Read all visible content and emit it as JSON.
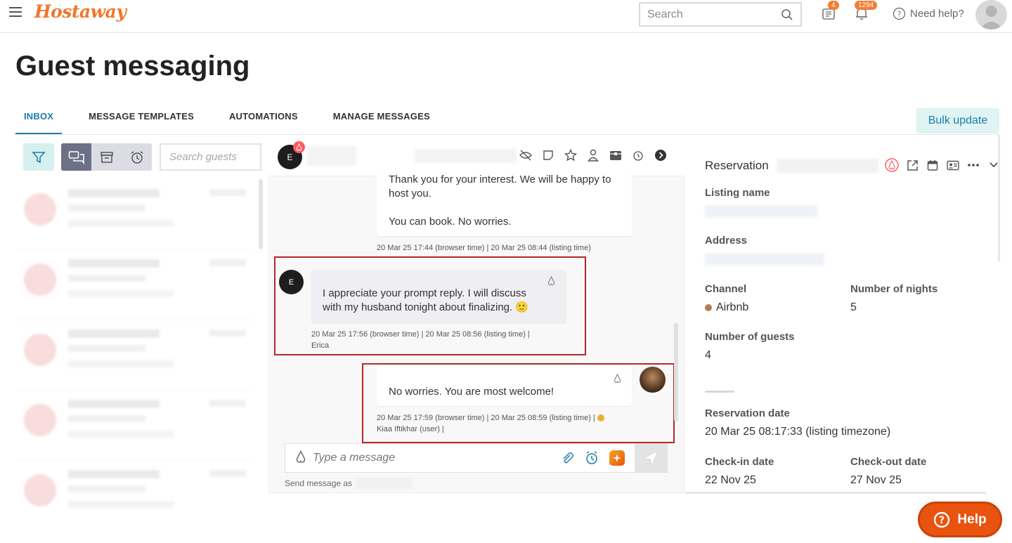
{
  "app": {
    "logo": "Hostaway"
  },
  "topbar": {
    "search_placeholder": "Search",
    "notifications_badge_1": "4",
    "notifications_badge_2": "1294",
    "need_help": "Need help?"
  },
  "page": {
    "title": "Guest messaging"
  },
  "tabs": [
    {
      "label": "INBOX",
      "active": true
    },
    {
      "label": "MESSAGE TEMPLATES"
    },
    {
      "label": "AUTOMATIONS"
    },
    {
      "label": "MANAGE MESSAGES"
    }
  ],
  "bulk_update": "Bulk update",
  "left": {
    "search_placeholder": "Search guests"
  },
  "chat": {
    "avatar_initial": "E",
    "messages": {
      "first_text_1": "Thank you for your interest. We will be happy to host you.",
      "first_text_2": "You can book. No worries.",
      "first_meta": "20 Mar 25 17:44 (browser time) | 20 Mar 25 08:44 (listing time)",
      "guest_initial": "E",
      "guest_text": "I appreciate your prompt reply. I will discuss with my husband tonight about finalizing. 🙂",
      "guest_meta_1": "20 Mar 25 17:56 (browser time) | 20 Mar 25 08:56 (listing time) |",
      "guest_meta_2": "Erica",
      "host_text": "No worries. You are most welcome!",
      "host_meta_1": "20 Mar 25 17:59 (browser time) | 20 Mar 25 08:59 (listing time) |",
      "host_meta_2": "Kiaa Iftikhar (user) |"
    },
    "composer_placeholder": "Type a message",
    "send_as": "Send message as"
  },
  "reservation": {
    "title": "Reservation",
    "listing_name_label": "Listing name",
    "address_label": "Address",
    "channel_label": "Channel",
    "channel_value": "Airbnb",
    "nights_label": "Number of nights",
    "nights_value": "5",
    "guests_label": "Number of guests",
    "guests_value": "4",
    "reservation_date_label": "Reservation date",
    "reservation_date_value": "20 Mar 25 08:17:33 (listing timezone)",
    "checkin_label": "Check-in date",
    "checkin_value": "22 Nov 25",
    "checkout_label": "Check-out date",
    "checkout_value": "27 Nov 25"
  },
  "help_button": "Help",
  "colors": {
    "accent": "#1f7bad",
    "brand": "#f2762a",
    "highlight": "#b22a2a",
    "help": "#e8530f"
  }
}
